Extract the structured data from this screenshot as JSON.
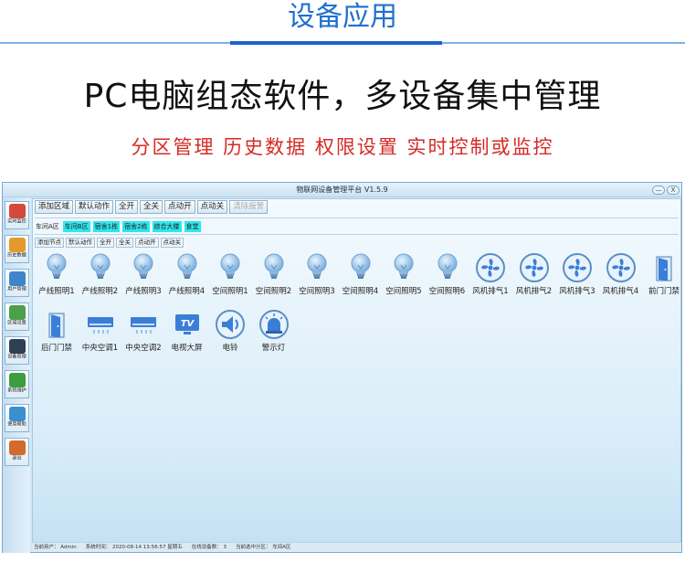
{
  "banner": {
    "title": "设备应用",
    "headline": "PC电脑组态软件，多设备集中管理",
    "subline": "分区管理 历史数据 权限设置 实时控制或监控"
  },
  "app": {
    "title": "物联网设备管理平台 V1.5.9",
    "window_min": "—",
    "window_close": "X",
    "sidebar": [
      {
        "label": "实时监控",
        "icon": "monitor-icon"
      },
      {
        "label": "历史数据",
        "icon": "chart-book-icon"
      },
      {
        "label": "用户管理",
        "icon": "users-icon"
      },
      {
        "label": "区域设置",
        "icon": "region-gear-icon"
      },
      {
        "label": "设备管理",
        "icon": "device-icon"
      },
      {
        "label": "系统维护",
        "icon": "refresh-icon"
      },
      {
        "label": "使用帮助",
        "icon": "help-icon"
      },
      {
        "label": "退出",
        "icon": "exit-door-icon"
      }
    ],
    "toolbar": [
      "添加区域",
      "默认动作",
      "全开",
      "全关",
      "点动开",
      "点动关",
      "清除报警"
    ],
    "zones": [
      {
        "label": "车间A区",
        "selected": false
      },
      {
        "label": "车间B区",
        "selected": true
      },
      {
        "label": "宿舍1栋",
        "selected": true
      },
      {
        "label": "宿舍2栋",
        "selected": true
      },
      {
        "label": "综合大楼",
        "selected": true
      },
      {
        "label": "食堂",
        "selected": true
      }
    ],
    "node_toolbar": [
      "添加节点",
      "默认动作",
      "全开",
      "全关",
      "点动开",
      "点动关"
    ],
    "devices": [
      {
        "label": "产线照明1",
        "icon": "bulb-icon"
      },
      {
        "label": "产线照明2",
        "icon": "bulb-icon"
      },
      {
        "label": "产线照明3",
        "icon": "bulb-icon"
      },
      {
        "label": "产线照明4",
        "icon": "bulb-icon"
      },
      {
        "label": "空间照明1",
        "icon": "bulb-icon"
      },
      {
        "label": "空间照明2",
        "icon": "bulb-icon"
      },
      {
        "label": "空间照明3",
        "icon": "bulb-icon"
      },
      {
        "label": "空间照明4",
        "icon": "bulb-icon"
      },
      {
        "label": "空间照明5",
        "icon": "bulb-icon"
      },
      {
        "label": "空间照明6",
        "icon": "bulb-icon"
      },
      {
        "label": "风机排气1",
        "icon": "fan-icon"
      },
      {
        "label": "风机排气2",
        "icon": "fan-icon"
      },
      {
        "label": "风机排气3",
        "icon": "fan-icon"
      },
      {
        "label": "风机排气4",
        "icon": "fan-icon"
      },
      {
        "label": "前门门禁",
        "icon": "door-icon"
      },
      {
        "label": "后门门禁",
        "icon": "door-icon"
      },
      {
        "label": "中央空调1",
        "icon": "air-conditioner-icon"
      },
      {
        "label": "中央空调2",
        "icon": "air-conditioner-icon"
      },
      {
        "label": "电视大屏",
        "icon": "tv-icon"
      },
      {
        "label": "电铃",
        "icon": "bell-speaker-icon"
      },
      {
        "label": "警示灯",
        "icon": "alarm-light-icon"
      }
    ],
    "status": {
      "user": "当前用户： Admin",
      "time": "系统时间： 2020-08-14 13:56:57 星期五",
      "online": "在线设备数： 3",
      "zone": "当前选中分区： 车间A区"
    }
  },
  "colors": {
    "brand_blue": "#1e6fd0",
    "accent_red": "#d42a26",
    "selected_zone": "#2ee6ef",
    "icon_blue": "#3a7ed8"
  }
}
